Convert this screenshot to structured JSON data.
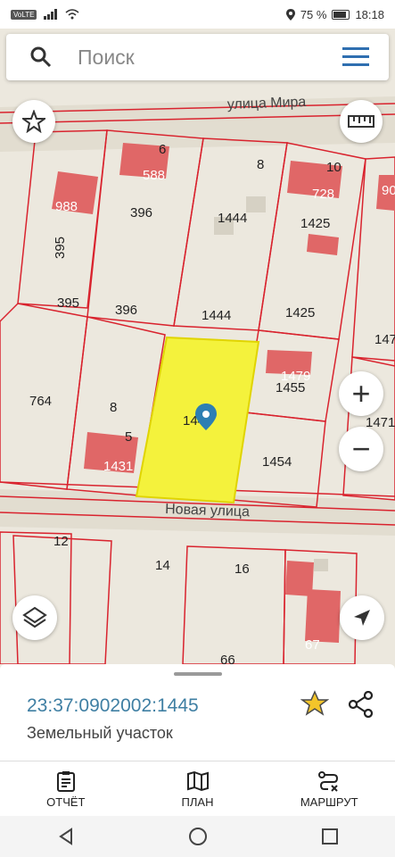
{
  "status": {
    "network_badge": "VoLTE",
    "battery": "75 %",
    "time": "18:18"
  },
  "search": {
    "placeholder": "Поиск",
    "search_icon": "search-icon",
    "menu_icon": "menu-icon"
  },
  "map": {
    "streets": [
      "улица Мира",
      "Новая улица"
    ],
    "parcel_labels": [
      "988",
      "396",
      "1444",
      "1425",
      "395",
      "395",
      "396",
      "1444",
      "1425",
      "764",
      "8",
      "1455",
      "1454",
      "1431",
      "1471",
      "147",
      "1445",
      "14",
      "16",
      "66",
      "67",
      "728",
      "588",
      "90",
      "12",
      "8",
      "5",
      "6",
      "1479",
      "10"
    ],
    "selected_parcel_color": "#f4f23c",
    "parcel_border_color": "#d9232e",
    "building_color": "#e06767"
  },
  "controls": {
    "favorite_icon": "star-icon",
    "ruler_icon": "ruler-icon",
    "zoom_in": "+",
    "zoom_out": "−",
    "layers_icon": "layers-icon",
    "location_icon": "navigation-arrow-icon"
  },
  "sheet": {
    "cadastral_number": "23:37:0902002:1445",
    "type": "Земельный участок"
  },
  "tabs": [
    {
      "label": "ОТЧЁТ",
      "icon": "report-icon"
    },
    {
      "label": "ПЛАН",
      "icon": "map-icon"
    },
    {
      "label": "МАРШРУТ",
      "icon": "route-icon"
    }
  ],
  "accent": "#2f6fb0",
  "star_color": "#f3c52a"
}
